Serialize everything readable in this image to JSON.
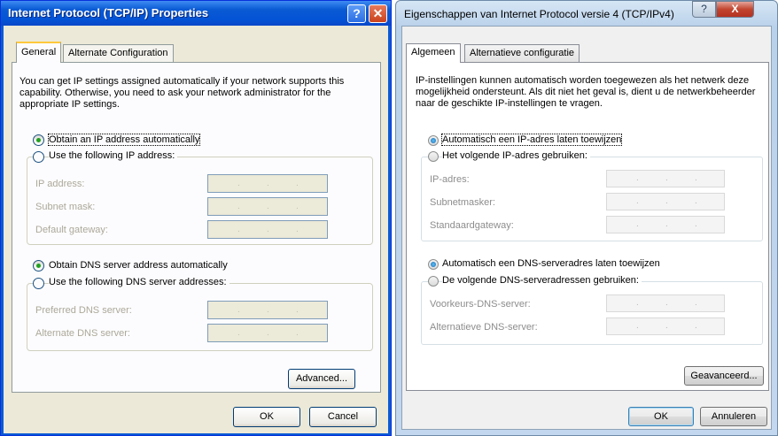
{
  "xp": {
    "title": "Internet Protocol (TCP/IP) Properties",
    "help_glyph": "?",
    "close_glyph": "✕",
    "tabs": [
      "General",
      "Alternate Configuration"
    ],
    "description": "You can get IP settings assigned automatically if your network supports this capability. Otherwise, you need to ask your network administrator for the appropriate IP settings.",
    "ip_auto": "Obtain an IP address automatically",
    "ip_manual": "Use the following IP address:",
    "ip_fields": [
      "IP address:",
      "Subnet mask:",
      "Default gateway:"
    ],
    "dns_auto": "Obtain DNS server address automatically",
    "dns_manual": "Use the following DNS server addresses:",
    "dns_fields": [
      "Preferred DNS server:",
      "Alternate DNS server:"
    ],
    "advanced": "Advanced...",
    "ok": "OK",
    "cancel": "Cancel",
    "ip_dots": "."
  },
  "vista": {
    "title": "Eigenschappen van Internet Protocol versie 4 (TCP/IPv4)",
    "help_glyph": "?",
    "close_glyph": "X",
    "tabs": [
      "Algemeen",
      "Alternatieve configuratie"
    ],
    "description": "IP-instellingen kunnen automatisch worden toegewezen als het netwerk deze mogelijkheid ondersteunt. Als dit niet het geval is, dient u de netwerkbeheerder naar de geschikte IP-instellingen te vragen.",
    "ip_auto": "Automatisch een IP-adres laten toewijzen",
    "ip_manual": "Het volgende IP-adres gebruiken:",
    "ip_fields": [
      "IP-adres:",
      "Subnetmasker:",
      "Standaardgateway:"
    ],
    "dns_auto": "Automatisch een DNS-serveradres laten toewijzen",
    "dns_manual": "De volgende DNS-serveradressen gebruiken:",
    "dns_fields": [
      "Voorkeurs-DNS-server:",
      "Alternatieve DNS-server:"
    ],
    "advanced": "Geavanceerd...",
    "ok": "OK",
    "cancel": "Annuleren",
    "ip_dots": "."
  }
}
